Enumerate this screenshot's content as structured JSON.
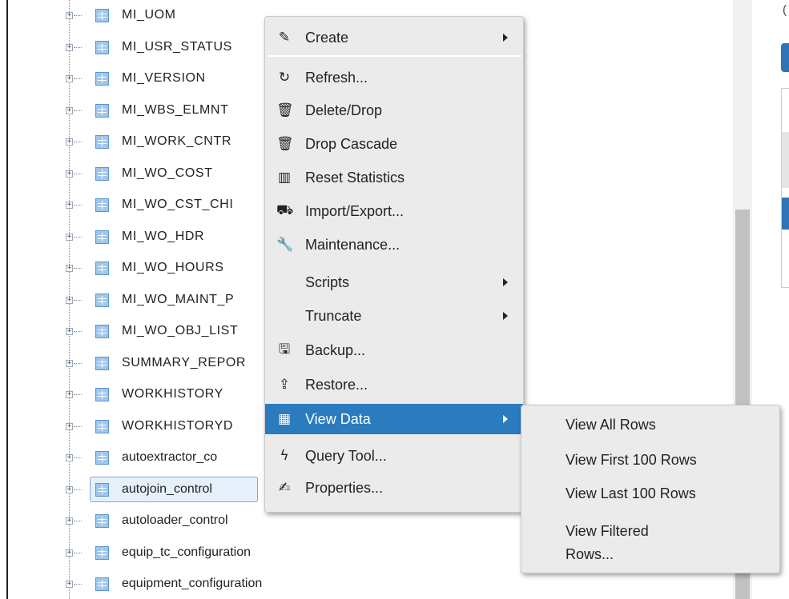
{
  "tree": {
    "items": [
      {
        "label": "MI_UOM"
      },
      {
        "label": "MI_USR_STATUS"
      },
      {
        "label": "MI_VERSION"
      },
      {
        "label": "MI_WBS_ELMNT"
      },
      {
        "label": "MI_WORK_CNTR"
      },
      {
        "label": "MI_WO_COST"
      },
      {
        "label": "MI_WO_CST_CHI"
      },
      {
        "label": "MI_WO_HDR"
      },
      {
        "label": "MI_WO_HOURS"
      },
      {
        "label": "MI_WO_MAINT_P"
      },
      {
        "label": "MI_WO_OBJ_LIST"
      },
      {
        "label": "SUMMARY_REPOR"
      },
      {
        "label": "WORKHISTORY"
      },
      {
        "label": "WORKHISTORYD"
      },
      {
        "label": "autoextractor_co"
      },
      {
        "label": "autojoin_control"
      },
      {
        "label": "autoloader_control"
      },
      {
        "label": "equip_tc_configuration"
      },
      {
        "label": "equipment_configuration"
      }
    ],
    "expander_glyph": "+"
  },
  "context_menu": {
    "items": [
      {
        "label": "Create",
        "icon": "magic-wand-icon",
        "glyph": "✎",
        "submenu": true
      },
      {
        "label": "Refresh...",
        "icon": "refresh-icon",
        "glyph": "↻"
      },
      {
        "label": "Delete/Drop",
        "icon": "trash-icon",
        "glyph": "🗑"
      },
      {
        "label": "Drop Cascade",
        "icon": "trash-icon",
        "glyph": "🗑"
      },
      {
        "label": "Reset Statistics",
        "icon": "bar-chart-icon",
        "glyph": "▥"
      },
      {
        "label": "Import/Export...",
        "icon": "cart-icon",
        "glyph": "⛟"
      },
      {
        "label": "Maintenance...",
        "icon": "wrench-icon",
        "glyph": "🔧"
      },
      {
        "label": "Scripts",
        "icon": "",
        "glyph": "",
        "submenu": true
      },
      {
        "label": "Truncate",
        "icon": "",
        "glyph": "",
        "submenu": true
      },
      {
        "label": "Backup...",
        "icon": "floppy-disk-icon",
        "glyph": "🖫"
      },
      {
        "label": "Restore...",
        "icon": "upload-icon",
        "glyph": "⇪"
      },
      {
        "label": "View Data",
        "icon": "table-grid-icon",
        "glyph": "▦",
        "submenu": true,
        "active": true
      },
      {
        "label": "Query Tool...",
        "icon": "bolt-icon",
        "glyph": "ϟ"
      },
      {
        "label": "Properties...",
        "icon": "edit-icon",
        "glyph": "✍"
      }
    ]
  },
  "view_data_submenu": {
    "items": [
      {
        "label": "View All Rows"
      },
      {
        "label": "View First 100 Rows"
      },
      {
        "label": "View Last 100 Rows"
      },
      {
        "label": "View Filtered"
      },
      {
        "label": "Rows..."
      }
    ]
  },
  "right_panel": {
    "char": "("
  },
  "colors": {
    "accent": "#2b7bbf",
    "menu_bg": "#ebebeb",
    "table_icon": "#9fc7ec"
  }
}
